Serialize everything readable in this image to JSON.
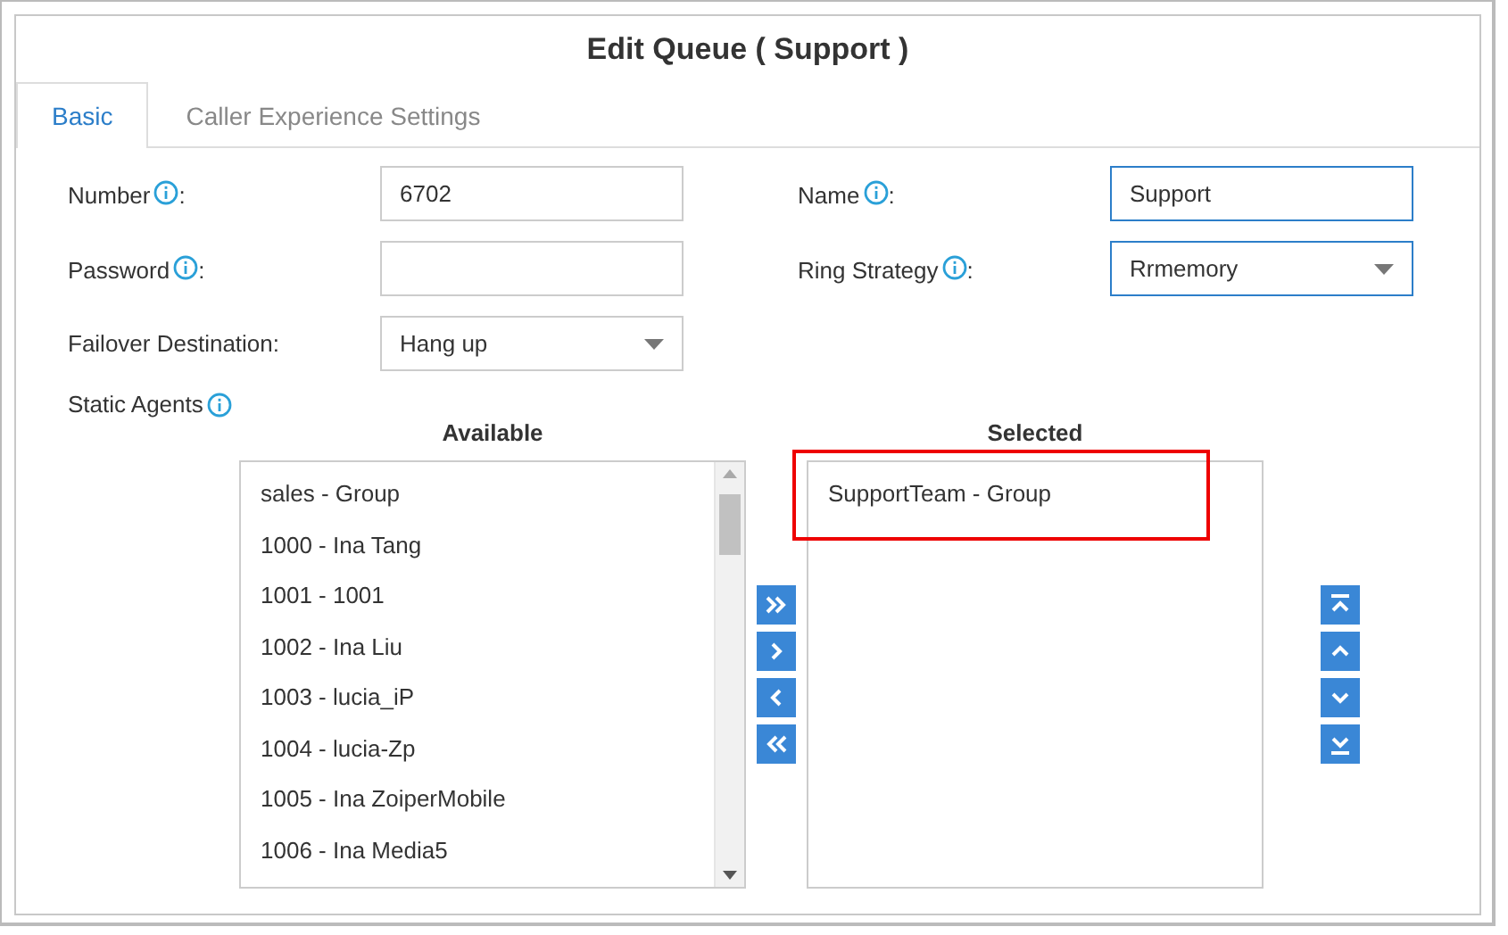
{
  "dialog": {
    "title": "Edit Queue ( Support )"
  },
  "tabs": [
    {
      "label": "Basic",
      "selected": true
    },
    {
      "label": "Caller Experience Settings",
      "selected": false
    }
  ],
  "fields": [
    {
      "label": "Number",
      "info": true,
      "separator": ":",
      "kind": "input",
      "value": "6702",
      "focused": false
    },
    {
      "label": "Name",
      "info": true,
      "separator": ":",
      "kind": "input",
      "value": "Support",
      "focused": true
    },
    {
      "label": "Password",
      "info": true,
      "separator": ":",
      "kind": "input",
      "focused": false
    },
    {
      "label": "Ring Strategy",
      "info": true,
      "separator": ":",
      "kind": "select",
      "value": "Rrmemory",
      "focused": true
    },
    {
      "label": "Failover Destination",
      "info": false,
      "separator": ":",
      "kind": "select",
      "value": "Hang up",
      "focused": false
    }
  ],
  "static_agents": {
    "label": "Static Agents",
    "available": {
      "heading": "Available",
      "items": [
        "sales - Group",
        "1000 - Ina Tang",
        "1001 - 1001",
        "1002 - Ina Liu",
        "1003 - lucia_iP",
        "1004 - lucia-Zp",
        "1005 - Ina ZoiperMobile",
        "1006 - Ina Media5"
      ]
    },
    "selected": {
      "heading": "Selected",
      "items": [
        {
          "label": "SupportTeam - Group",
          "highlighted": true
        }
      ]
    }
  }
}
